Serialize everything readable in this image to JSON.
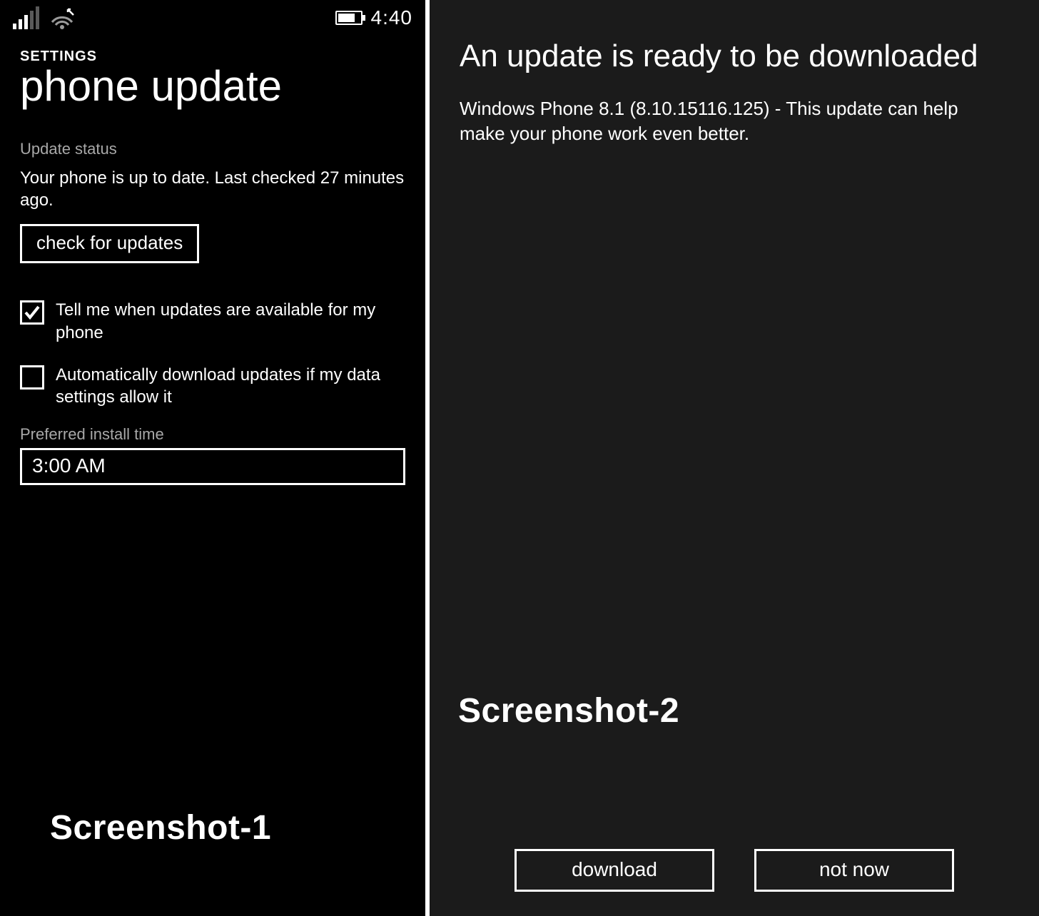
{
  "left": {
    "status_bar": {
      "clock": "4:40"
    },
    "breadcrumb": "SETTINGS",
    "title": "phone update",
    "section_label": "Update status",
    "status_text": "Your phone is up to date. Last checked 27 minutes ago.",
    "check_button": "check for updates",
    "checkboxes": [
      {
        "label": "Tell me when updates are available for my phone",
        "checked": true
      },
      {
        "label": "Automatically download updates if my data settings allow it",
        "checked": false
      }
    ],
    "install_time_label": "Preferred install time",
    "install_time_value": "3:00 AM",
    "overlay_caption": "Screenshot-1"
  },
  "right": {
    "title": "An update is ready to be downloaded",
    "body": "Windows Phone 8.1 (8.10.15116.125) - This update can help make your phone work even better.",
    "download_label": "download",
    "notnow_label": "not now",
    "overlay_caption": "Screenshot-2"
  }
}
